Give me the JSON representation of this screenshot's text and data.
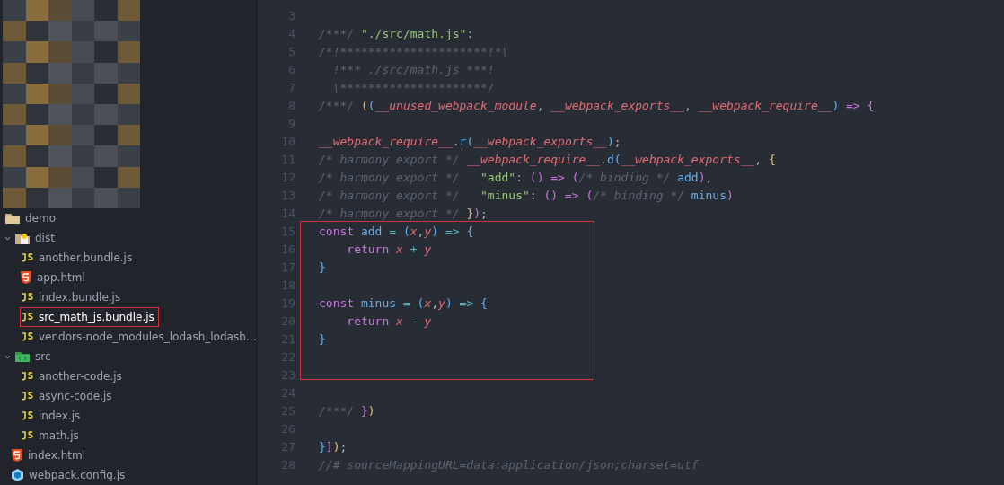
{
  "file_tree": [
    {
      "label": "demo",
      "kind": "folder",
      "children": [
        {
          "label": "dist",
          "kind": "folder-dist",
          "expanded": true,
          "children": [
            {
              "label": "another.bundle.js",
              "kind": "js",
              "selected": false
            },
            {
              "label": "app.html",
              "kind": "html",
              "selected": false
            },
            {
              "label": "index.bundle.js",
              "kind": "js",
              "selected": false
            },
            {
              "label": "src_math_js.bundle.js",
              "kind": "js",
              "selected": true
            },
            {
              "label": "vendors-node_modules_lodash_lodash…",
              "kind": "js",
              "selected": false
            }
          ]
        },
        {
          "label": "src",
          "kind": "folder-src",
          "expanded": true,
          "children": [
            {
              "label": "another-code.js",
              "kind": "js",
              "selected": false
            },
            {
              "label": "async-code.js",
              "kind": "js",
              "selected": false
            },
            {
              "label": "index.js",
              "kind": "js",
              "selected": false
            },
            {
              "label": "math.js",
              "kind": "js",
              "selected": false
            }
          ]
        },
        {
          "label": "index.html",
          "kind": "html",
          "selected": false
        },
        {
          "label": "webpack.config.js",
          "kind": "webpack",
          "selected": false
        }
      ]
    }
  ],
  "editor": {
    "lines": [
      {
        "number": "3"
      },
      {
        "number": "4",
        "tokens": [
          {
            "text": "/***/ ",
            "kind": "comment"
          },
          {
            "text": "\"./src/math.js\"",
            "kind": "string"
          },
          {
            "text": ":",
            "kind": "plain"
          }
        ]
      },
      {
        "number": "5",
        "tokens": [
          {
            "text": "/*!*********************!*\\",
            "kind": "comment"
          }
        ]
      },
      {
        "number": "6",
        "tokens": [
          {
            "text": "  !*** ./src/math.js ***!",
            "kind": "comment"
          }
        ]
      },
      {
        "number": "7",
        "tokens": [
          {
            "text": "  \\*********************/",
            "kind": "comment"
          }
        ]
      },
      {
        "number": "8",
        "tokens": [
          {
            "text": "/***/ ",
            "kind": "comment"
          },
          {
            "text": "(",
            "kind": "brace-gold"
          },
          {
            "text": "(",
            "kind": "brace-blue"
          },
          {
            "text": "__unused_webpack_module",
            "kind": "var"
          },
          {
            "text": ", ",
            "kind": "plain"
          },
          {
            "text": "__webpack_exports__",
            "kind": "var"
          },
          {
            "text": ", ",
            "kind": "plain"
          },
          {
            "text": "__webpack_require__",
            "kind": "var"
          },
          {
            "text": ")",
            "kind": "brace-blue"
          },
          {
            "text": " => {",
            "kind": "kw"
          }
        ]
      },
      {
        "number": "9"
      },
      {
        "number": "10",
        "tokens": [
          {
            "text": "__webpack_require__",
            "kind": "var"
          },
          {
            "text": ".",
            "kind": "plain"
          },
          {
            "text": "r",
            "kind": "fn"
          },
          {
            "text": "(",
            "kind": "brace-blue"
          },
          {
            "text": "__webpack_exports__",
            "kind": "var"
          },
          {
            "text": ")",
            "kind": "brace-blue"
          },
          {
            "text": ";",
            "kind": "plain"
          }
        ]
      },
      {
        "number": "11",
        "tokens": [
          {
            "text": "/* harmony export */ ",
            "kind": "comment"
          },
          {
            "text": "__webpack_require__",
            "kind": "var"
          },
          {
            "text": ".",
            "kind": "plain"
          },
          {
            "text": "d",
            "kind": "fn"
          },
          {
            "text": "(",
            "kind": "brace-blue"
          },
          {
            "text": "__webpack_exports__",
            "kind": "var"
          },
          {
            "text": ", ",
            "kind": "plain"
          },
          {
            "text": "{",
            "kind": "brace-gold"
          }
        ]
      },
      {
        "number": "12",
        "tokens": [
          {
            "text": "/* harmony export */   ",
            "kind": "comment"
          },
          {
            "text": "\"add\"",
            "kind": "string"
          },
          {
            "text": ": ",
            "kind": "plain"
          },
          {
            "text": "()",
            "kind": "kw"
          },
          {
            "text": " => ",
            "kind": "kw"
          },
          {
            "text": "(",
            "kind": "kw"
          },
          {
            "text": "/* binding */ ",
            "kind": "comment"
          },
          {
            "text": "add",
            "kind": "fn"
          },
          {
            "text": ")",
            "kind": "kw"
          },
          {
            "text": ",",
            "kind": "plain"
          }
        ]
      },
      {
        "number": "13",
        "tokens": [
          {
            "text": "/* harmony export */   ",
            "kind": "comment"
          },
          {
            "text": "\"minus\"",
            "kind": "string"
          },
          {
            "text": ": ",
            "kind": "plain"
          },
          {
            "text": "()",
            "kind": "kw"
          },
          {
            "text": " => ",
            "kind": "kw"
          },
          {
            "text": "(",
            "kind": "kw"
          },
          {
            "text": "/* binding */ ",
            "kind": "comment"
          },
          {
            "text": "minus",
            "kind": "fn"
          },
          {
            "text": ")",
            "kind": "kw"
          }
        ]
      },
      {
        "number": "14",
        "tokens": [
          {
            "text": "/* harmony export */ ",
            "kind": "comment"
          },
          {
            "text": "}",
            "kind": "brace-gold"
          },
          {
            "text": ")",
            "kind": "kw"
          },
          {
            "text": ";",
            "kind": "plain"
          }
        ]
      },
      {
        "number": "15",
        "tokens": [
          {
            "text": "const ",
            "kind": "kw"
          },
          {
            "text": "add",
            "kind": "fn"
          },
          {
            "text": " = ",
            "kind": "op"
          },
          {
            "text": "(",
            "kind": "brace-blue"
          },
          {
            "text": "x",
            "kind": "var"
          },
          {
            "text": ",",
            "kind": "plain"
          },
          {
            "text": "y",
            "kind": "var"
          },
          {
            "text": ")",
            "kind": "brace-blue"
          },
          {
            "text": " => ",
            "kind": "op"
          },
          {
            "text": "{",
            "kind": "brace-blue"
          }
        ]
      },
      {
        "number": "16",
        "tokens": [
          {
            "text": "    return ",
            "kind": "kw"
          },
          {
            "text": "x",
            "kind": "var"
          },
          {
            "text": " + ",
            "kind": "op"
          },
          {
            "text": "y",
            "kind": "var"
          }
        ]
      },
      {
        "number": "17",
        "tokens": [
          {
            "text": "}",
            "kind": "brace-blue"
          }
        ]
      },
      {
        "number": "18"
      },
      {
        "number": "19",
        "tokens": [
          {
            "text": "const ",
            "kind": "kw"
          },
          {
            "text": "minus",
            "kind": "fn"
          },
          {
            "text": " = ",
            "kind": "op"
          },
          {
            "text": "(",
            "kind": "brace-blue"
          },
          {
            "text": "x",
            "kind": "var"
          },
          {
            "text": ",",
            "kind": "plain"
          },
          {
            "text": "y",
            "kind": "var"
          },
          {
            "text": ")",
            "kind": "brace-blue"
          },
          {
            "text": " => ",
            "kind": "op"
          },
          {
            "text": "{",
            "kind": "brace-blue"
          }
        ]
      },
      {
        "number": "20",
        "tokens": [
          {
            "text": "    return ",
            "kind": "kw"
          },
          {
            "text": "x",
            "kind": "var"
          },
          {
            "text": " - ",
            "kind": "op"
          },
          {
            "text": "y",
            "kind": "var"
          }
        ]
      },
      {
        "number": "21",
        "tokens": [
          {
            "text": "}",
            "kind": "brace-blue"
          }
        ]
      },
      {
        "number": "22"
      },
      {
        "number": "23"
      },
      {
        "number": "24"
      },
      {
        "number": "25",
        "tokens": [
          {
            "text": "/***/ ",
            "kind": "comment"
          },
          {
            "text": "}",
            "kind": "kw"
          },
          {
            "text": ")",
            "kind": "brace-gold"
          }
        ]
      },
      {
        "number": "26"
      },
      {
        "number": "27",
        "tokens": [
          {
            "text": "}",
            "kind": "brace-blue"
          },
          {
            "text": "]",
            "kind": "kw"
          },
          {
            "text": ")",
            "kind": "brace-gold"
          },
          {
            "text": ";",
            "kind": "plain"
          }
        ]
      },
      {
        "number": "28",
        "tokens": [
          {
            "text": "//# sourceMappingURL=data:application/json;charset=utf",
            "kind": "comment"
          }
        ]
      }
    ]
  }
}
